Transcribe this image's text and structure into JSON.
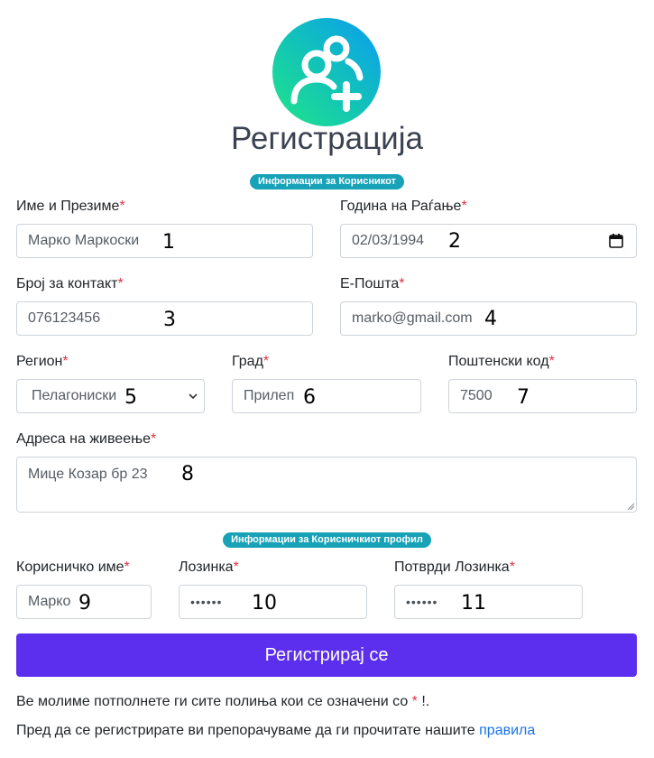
{
  "header": {
    "title": "Регистрација",
    "logo_icon": "user-plus-icon"
  },
  "sections": {
    "user_info": "Информации за Корисникот",
    "profile_info": "Информации за Корисничкиот профил"
  },
  "required_marker": "*",
  "fields": {
    "full_name": {
      "label": "Име и Презиме",
      "value": "Марко Маркоски",
      "marker": "1"
    },
    "birth_date": {
      "label": "Година на Раѓање",
      "value": "02/03/1994",
      "marker": "2"
    },
    "phone": {
      "label": "Број за контакт",
      "value": "076123456",
      "marker": "3"
    },
    "email": {
      "label": "Е-Пошта",
      "value": "marko@gmail.com",
      "marker": "4"
    },
    "region": {
      "label": "Регион",
      "value": "Пелагониски",
      "marker": "5"
    },
    "city": {
      "label": "Град",
      "value": "Прилеп",
      "marker": "6"
    },
    "postal_code": {
      "label": "Поштенски код",
      "value": "7500",
      "marker": "7"
    },
    "address": {
      "label": "Адреса на живеење",
      "value": "Мице Козар бр 23",
      "marker": "8"
    },
    "username": {
      "label": "Корисничко име",
      "value": "Марко",
      "marker": "9"
    },
    "password": {
      "label": "Лозинка",
      "value": "••••••",
      "marker": "10"
    },
    "confirm_password": {
      "label": "Потврди Лозинка",
      "value": "••••••",
      "marker": "11"
    }
  },
  "submit_label": "Регистрирај се",
  "notes": {
    "required_prefix": "Ве молиме потполнете ги сите полиња кои се означени со ",
    "required_star": "*",
    "required_suffix": " !.",
    "rules_prefix": "Пред да се регистрирате ви препорачуваме да ги прочитате нашите ",
    "rules_link": "правила"
  },
  "colors": {
    "accent": "#5c2eed",
    "badge": "#17a2b8",
    "required": "#dc3545",
    "link": "#1a73e8"
  }
}
